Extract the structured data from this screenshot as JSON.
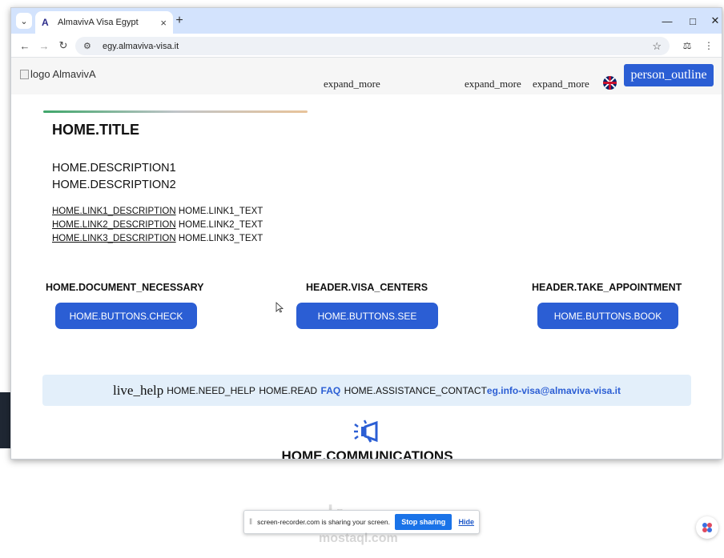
{
  "browser": {
    "tab_title": "AlmavivA Visa Egypt",
    "tab_favicon": "A",
    "url": "egy.almaviva-visa.it",
    "icons": [
      "tab-list-icon",
      "close-icon",
      "new-tab-icon",
      "minimize-icon",
      "maximize-icon",
      "close-window-icon",
      "back-icon",
      "forward-icon",
      "reload-icon",
      "site-info-icon",
      "star-icon",
      "labs-icon",
      "menu-icon"
    ]
  },
  "header": {
    "logo_alt": "logo AlmavivA",
    "menu_1": "expand_more",
    "menu_2": "expand_more",
    "menu_3": "expand_more",
    "user_button": "person_outline"
  },
  "home": {
    "title": "HOME.TITLE",
    "description1": "HOME.DESCRIPTION1",
    "description2": "HOME.DESCRIPTION2",
    "links": [
      {
        "description": "HOME.LINK1_DESCRIPTION",
        "text": "HOME.LINK1_TEXT"
      },
      {
        "description": "HOME.LINK2_DESCRIPTION",
        "text": "HOME.LINK2_TEXT"
      },
      {
        "description": "HOME.LINK3_DESCRIPTION",
        "text": "HOME.LINK3_TEXT"
      }
    ]
  },
  "sections": [
    {
      "title": "HOME.DOCUMENT_NECESSARY",
      "button": "HOME.BUTTONS.CHECK"
    },
    {
      "title": "HEADER.VISA_CENTERS",
      "button": "HOME.BUTTONS.SEE"
    },
    {
      "title": "HEADER.TAKE_APPOINTMENT",
      "button": "HOME.BUTTONS.BOOK"
    }
  ],
  "help": {
    "icon_text": "live_help",
    "need_help": "HOME.NEED_HELP",
    "read": "HOME.READ",
    "faq": "FAQ",
    "assistance": "HOME.ASSISTANCE_CONTACT",
    "email": "eg.info-visa@almaviva-visa.it"
  },
  "communications": {
    "title": "HOME.COMMUNICATIONS"
  },
  "share_bar": {
    "message": "screen-recorder.com is sharing your screen.",
    "stop_label": "Stop sharing",
    "hide_label": "Hide"
  },
  "watermark": {
    "arabic": "مستقل",
    "latin": "mostaql.com"
  },
  "colors": {
    "accent": "#2b5ed4",
    "tabbar": "#d3e3fd",
    "help_bg": "#e3effa"
  }
}
